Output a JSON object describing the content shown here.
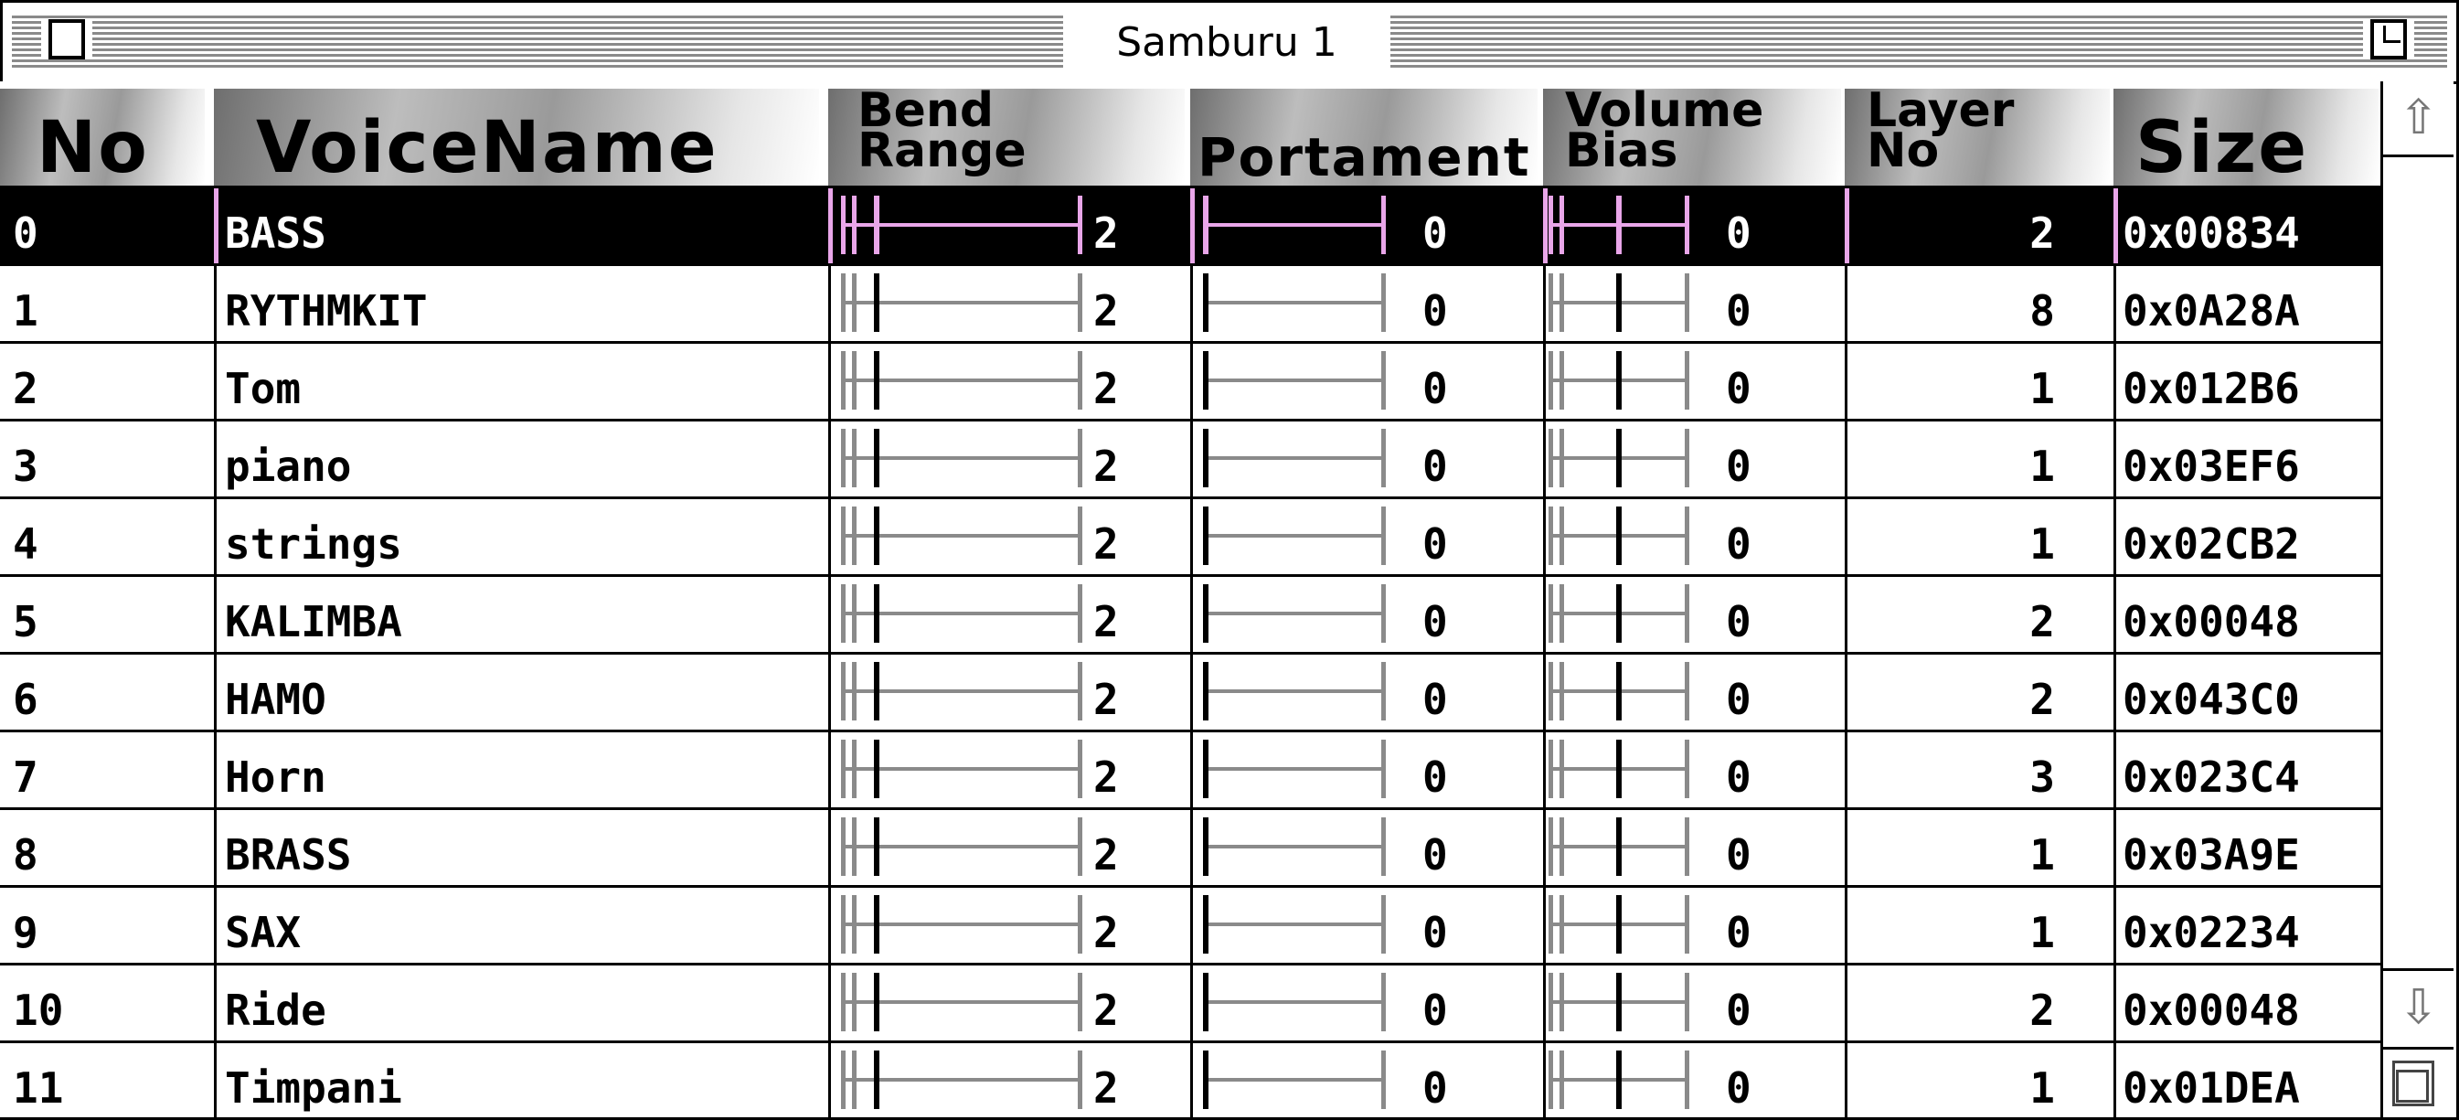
{
  "window": {
    "title": "Samburu 1"
  },
  "columns": {
    "no": "No",
    "voice_name": "VoiceName",
    "bend_range_1": "Bend",
    "bend_range_2": "Range",
    "portament": "Portament",
    "volume_bias_1": "Volume",
    "volume_bias_2": "Bias",
    "layer_no_1": "Layer",
    "layer_no_2": "No",
    "size": "Size"
  },
  "rows": [
    {
      "no": "0",
      "name": "BASS",
      "bend": "2",
      "portament": "0",
      "volume_bias": "0",
      "layer": "2",
      "size": "0x00834",
      "selected": true
    },
    {
      "no": "1",
      "name": "RYTHMKIT",
      "bend": "2",
      "portament": "0",
      "volume_bias": "0",
      "layer": "8",
      "size": "0x0A28A"
    },
    {
      "no": "2",
      "name": "Tom",
      "bend": "2",
      "portament": "0",
      "volume_bias": "0",
      "layer": "1",
      "size": "0x012B6"
    },
    {
      "no": "3",
      "name": "piano",
      "bend": "2",
      "portament": "0",
      "volume_bias": "0",
      "layer": "1",
      "size": "0x03EF6"
    },
    {
      "no": "4",
      "name": "strings",
      "bend": "2",
      "portament": "0",
      "volume_bias": "0",
      "layer": "1",
      "size": "0x02CB2"
    },
    {
      "no": "5",
      "name": "KALIMBA",
      "bend": "2",
      "portament": "0",
      "volume_bias": "0",
      "layer": "2",
      "size": "0x00048"
    },
    {
      "no": "6",
      "name": "HAMO",
      "bend": "2",
      "portament": "0",
      "volume_bias": "0",
      "layer": "2",
      "size": "0x043C0"
    },
    {
      "no": "7",
      "name": "Horn",
      "bend": "2",
      "portament": "0",
      "volume_bias": "0",
      "layer": "3",
      "size": "0x023C4"
    },
    {
      "no": "8",
      "name": "BRASS",
      "bend": "2",
      "portament": "0",
      "volume_bias": "0",
      "layer": "1",
      "size": "0x03A9E"
    },
    {
      "no": "9",
      "name": "SAX",
      "bend": "2",
      "portament": "0",
      "volume_bias": "0",
      "layer": "1",
      "size": "0x02234"
    },
    {
      "no": "10",
      "name": "Ride",
      "bend": "2",
      "portament": "0",
      "volume_bias": "0",
      "layer": "2",
      "size": "0x00048"
    },
    {
      "no": "11",
      "name": "Timpani",
      "bend": "2",
      "portament": "0",
      "volume_bias": "0",
      "layer": "1",
      "size": "0x01DEA"
    }
  ],
  "colors": {
    "selection_bg": "#000000",
    "selection_accent": "#e9a6e9",
    "slider": "#8a8a8a"
  },
  "icons": {
    "close": "close-box-icon",
    "zoom": "zoom-box-icon",
    "scroll_up": "arrow-up-icon",
    "scroll_down": "arrow-down-icon",
    "grow": "resize-icon"
  }
}
